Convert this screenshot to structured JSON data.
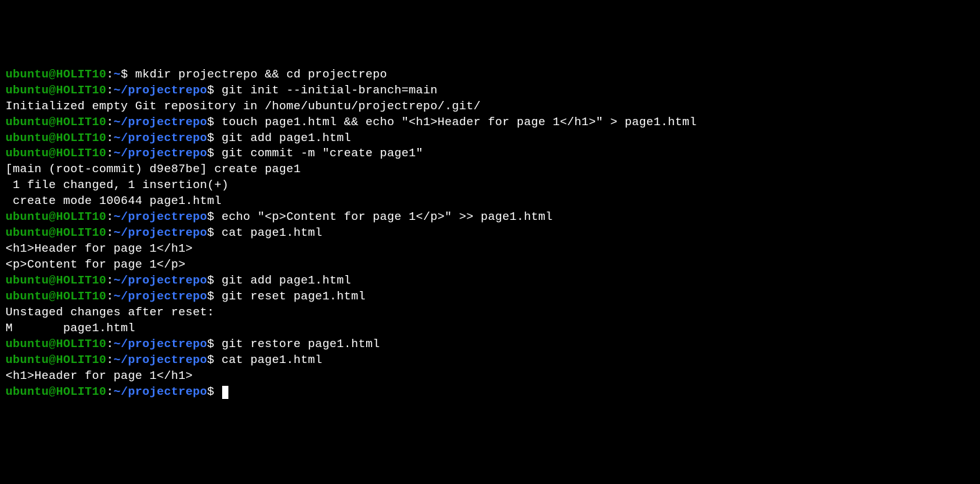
{
  "prompt": {
    "user": "ubuntu",
    "at": "@",
    "host": "HOLIT10",
    "colon": ":",
    "tilde": "~",
    "path_suffix": "/projectrepo",
    "dollar": "$"
  },
  "lines": [
    {
      "type": "prompt_home",
      "cmd": " mkdir projectrepo && cd projectrepo"
    },
    {
      "type": "prompt_repo",
      "cmd": " git init --initial-branch=main"
    },
    {
      "type": "output",
      "text": "Initialized empty Git repository in /home/ubuntu/projectrepo/.git/"
    },
    {
      "type": "prompt_repo",
      "cmd": " touch page1.html && echo \"<h1>Header for page 1</h1>\" > page1.html"
    },
    {
      "type": "prompt_repo",
      "cmd": " git add page1.html"
    },
    {
      "type": "prompt_repo",
      "cmd": " git commit -m \"create page1\""
    },
    {
      "type": "output",
      "text": "[main (root-commit) d9e87be] create page1"
    },
    {
      "type": "output",
      "text": " 1 file changed, 1 insertion(+)"
    },
    {
      "type": "output",
      "text": " create mode 100644 page1.html"
    },
    {
      "type": "prompt_repo",
      "cmd": " echo \"<p>Content for page 1</p>\" >> page1.html"
    },
    {
      "type": "prompt_repo",
      "cmd": " cat page1.html"
    },
    {
      "type": "output",
      "text": "<h1>Header for page 1</h1>"
    },
    {
      "type": "output",
      "text": "<p>Content for page 1</p>"
    },
    {
      "type": "prompt_repo",
      "cmd": " git add page1.html"
    },
    {
      "type": "prompt_repo",
      "cmd": " git reset page1.html"
    },
    {
      "type": "output",
      "text": "Unstaged changes after reset:"
    },
    {
      "type": "output",
      "text": "M       page1.html"
    },
    {
      "type": "prompt_repo",
      "cmd": " git restore page1.html"
    },
    {
      "type": "prompt_repo",
      "cmd": " cat page1.html"
    },
    {
      "type": "output",
      "text": "<h1>Header for page 1</h1>"
    },
    {
      "type": "prompt_repo_cursor",
      "cmd": " "
    }
  ]
}
